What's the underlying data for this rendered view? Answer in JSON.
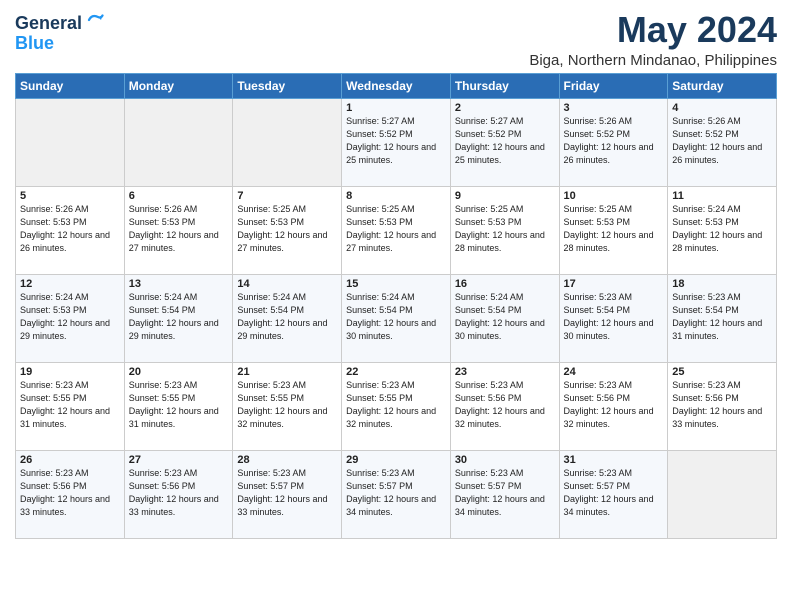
{
  "header": {
    "logo_line1": "General",
    "logo_line2": "Blue",
    "month": "May 2024",
    "location": "Biga, Northern Mindanao, Philippines"
  },
  "days_of_week": [
    "Sunday",
    "Monday",
    "Tuesday",
    "Wednesday",
    "Thursday",
    "Friday",
    "Saturday"
  ],
  "weeks": [
    [
      {
        "day": "",
        "sunrise": "",
        "sunset": "",
        "daylight": "",
        "empty": true
      },
      {
        "day": "",
        "sunrise": "",
        "sunset": "",
        "daylight": "",
        "empty": true
      },
      {
        "day": "",
        "sunrise": "",
        "sunset": "",
        "daylight": "",
        "empty": true
      },
      {
        "day": "1",
        "sunrise": "Sunrise: 5:27 AM",
        "sunset": "Sunset: 5:52 PM",
        "daylight": "Daylight: 12 hours and 25 minutes."
      },
      {
        "day": "2",
        "sunrise": "Sunrise: 5:27 AM",
        "sunset": "Sunset: 5:52 PM",
        "daylight": "Daylight: 12 hours and 25 minutes."
      },
      {
        "day": "3",
        "sunrise": "Sunrise: 5:26 AM",
        "sunset": "Sunset: 5:52 PM",
        "daylight": "Daylight: 12 hours and 26 minutes."
      },
      {
        "day": "4",
        "sunrise": "Sunrise: 5:26 AM",
        "sunset": "Sunset: 5:52 PM",
        "daylight": "Daylight: 12 hours and 26 minutes."
      }
    ],
    [
      {
        "day": "5",
        "sunrise": "Sunrise: 5:26 AM",
        "sunset": "Sunset: 5:53 PM",
        "daylight": "Daylight: 12 hours and 26 minutes."
      },
      {
        "day": "6",
        "sunrise": "Sunrise: 5:26 AM",
        "sunset": "Sunset: 5:53 PM",
        "daylight": "Daylight: 12 hours and 27 minutes."
      },
      {
        "day": "7",
        "sunrise": "Sunrise: 5:25 AM",
        "sunset": "Sunset: 5:53 PM",
        "daylight": "Daylight: 12 hours and 27 minutes."
      },
      {
        "day": "8",
        "sunrise": "Sunrise: 5:25 AM",
        "sunset": "Sunset: 5:53 PM",
        "daylight": "Daylight: 12 hours and 27 minutes."
      },
      {
        "day": "9",
        "sunrise": "Sunrise: 5:25 AM",
        "sunset": "Sunset: 5:53 PM",
        "daylight": "Daylight: 12 hours and 28 minutes."
      },
      {
        "day": "10",
        "sunrise": "Sunrise: 5:25 AM",
        "sunset": "Sunset: 5:53 PM",
        "daylight": "Daylight: 12 hours and 28 minutes."
      },
      {
        "day": "11",
        "sunrise": "Sunrise: 5:24 AM",
        "sunset": "Sunset: 5:53 PM",
        "daylight": "Daylight: 12 hours and 28 minutes."
      }
    ],
    [
      {
        "day": "12",
        "sunrise": "Sunrise: 5:24 AM",
        "sunset": "Sunset: 5:53 PM",
        "daylight": "Daylight: 12 hours and 29 minutes."
      },
      {
        "day": "13",
        "sunrise": "Sunrise: 5:24 AM",
        "sunset": "Sunset: 5:54 PM",
        "daylight": "Daylight: 12 hours and 29 minutes."
      },
      {
        "day": "14",
        "sunrise": "Sunrise: 5:24 AM",
        "sunset": "Sunset: 5:54 PM",
        "daylight": "Daylight: 12 hours and 29 minutes."
      },
      {
        "day": "15",
        "sunrise": "Sunrise: 5:24 AM",
        "sunset": "Sunset: 5:54 PM",
        "daylight": "Daylight: 12 hours and 30 minutes."
      },
      {
        "day": "16",
        "sunrise": "Sunrise: 5:24 AM",
        "sunset": "Sunset: 5:54 PM",
        "daylight": "Daylight: 12 hours and 30 minutes."
      },
      {
        "day": "17",
        "sunrise": "Sunrise: 5:23 AM",
        "sunset": "Sunset: 5:54 PM",
        "daylight": "Daylight: 12 hours and 30 minutes."
      },
      {
        "day": "18",
        "sunrise": "Sunrise: 5:23 AM",
        "sunset": "Sunset: 5:54 PM",
        "daylight": "Daylight: 12 hours and 31 minutes."
      }
    ],
    [
      {
        "day": "19",
        "sunrise": "Sunrise: 5:23 AM",
        "sunset": "Sunset: 5:55 PM",
        "daylight": "Daylight: 12 hours and 31 minutes."
      },
      {
        "day": "20",
        "sunrise": "Sunrise: 5:23 AM",
        "sunset": "Sunset: 5:55 PM",
        "daylight": "Daylight: 12 hours and 31 minutes."
      },
      {
        "day": "21",
        "sunrise": "Sunrise: 5:23 AM",
        "sunset": "Sunset: 5:55 PM",
        "daylight": "Daylight: 12 hours and 32 minutes."
      },
      {
        "day": "22",
        "sunrise": "Sunrise: 5:23 AM",
        "sunset": "Sunset: 5:55 PM",
        "daylight": "Daylight: 12 hours and 32 minutes."
      },
      {
        "day": "23",
        "sunrise": "Sunrise: 5:23 AM",
        "sunset": "Sunset: 5:56 PM",
        "daylight": "Daylight: 12 hours and 32 minutes."
      },
      {
        "day": "24",
        "sunrise": "Sunrise: 5:23 AM",
        "sunset": "Sunset: 5:56 PM",
        "daylight": "Daylight: 12 hours and 32 minutes."
      },
      {
        "day": "25",
        "sunrise": "Sunrise: 5:23 AM",
        "sunset": "Sunset: 5:56 PM",
        "daylight": "Daylight: 12 hours and 33 minutes."
      }
    ],
    [
      {
        "day": "26",
        "sunrise": "Sunrise: 5:23 AM",
        "sunset": "Sunset: 5:56 PM",
        "daylight": "Daylight: 12 hours and 33 minutes."
      },
      {
        "day": "27",
        "sunrise": "Sunrise: 5:23 AM",
        "sunset": "Sunset: 5:56 PM",
        "daylight": "Daylight: 12 hours and 33 minutes."
      },
      {
        "day": "28",
        "sunrise": "Sunrise: 5:23 AM",
        "sunset": "Sunset: 5:57 PM",
        "daylight": "Daylight: 12 hours and 33 minutes."
      },
      {
        "day": "29",
        "sunrise": "Sunrise: 5:23 AM",
        "sunset": "Sunset: 5:57 PM",
        "daylight": "Daylight: 12 hours and 34 minutes."
      },
      {
        "day": "30",
        "sunrise": "Sunrise: 5:23 AM",
        "sunset": "Sunset: 5:57 PM",
        "daylight": "Daylight: 12 hours and 34 minutes."
      },
      {
        "day": "31",
        "sunrise": "Sunrise: 5:23 AM",
        "sunset": "Sunset: 5:57 PM",
        "daylight": "Daylight: 12 hours and 34 minutes."
      },
      {
        "day": "",
        "sunrise": "",
        "sunset": "",
        "daylight": "",
        "empty": true
      }
    ]
  ]
}
